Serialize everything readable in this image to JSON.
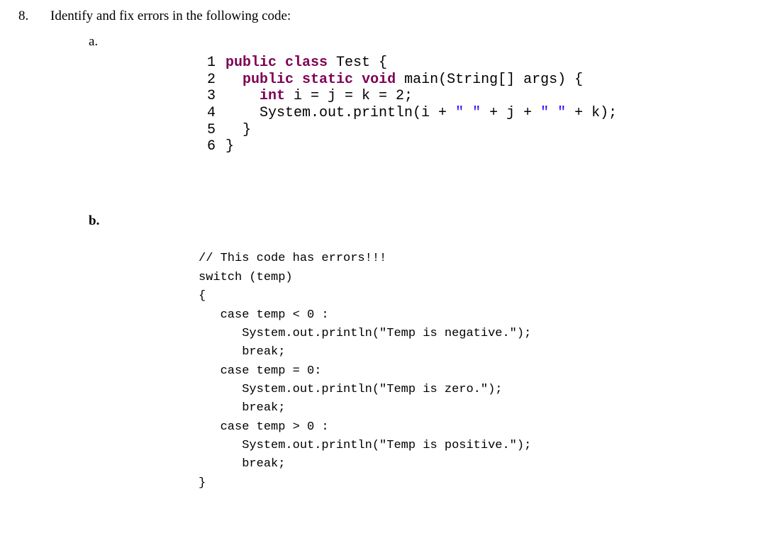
{
  "question": {
    "number": "8.",
    "prompt": "Identify and fix errors in the following code:"
  },
  "a": {
    "label": "a.",
    "lines": {
      "n1": "1",
      "n2": "2",
      "n3": "3",
      "n4": "4",
      "n5": "5",
      "n6": "6",
      "l1_kw1": "public",
      "l1_kw2": "class",
      "l1_cls": " Test {",
      "l2_kw1": "public",
      "l2_kw2": "static",
      "l2_kw3": "void",
      "l2_m": " main(String[] args) {",
      "l3_kw": "int",
      "l3_rest": " i = j = k = 2;",
      "l4_pre": "    System.out.println(i + ",
      "l4_s1": "\" \"",
      "l4_mid": " + j + ",
      "l4_s2": "\" \"",
      "l4_post": " + k);",
      "l5": "  }",
      "l6": "}"
    }
  },
  "b": {
    "label": "b.",
    "lines": {
      "c1": "// This code has errors!!!",
      "c2": "switch (temp)",
      "c3": "{",
      "c4": "   case temp < 0 :",
      "c5_pre": "      System.out.println(",
      "c5_str": "\"Temp is negative.\"",
      "c5_post": ");",
      "c6": "      break;",
      "c7": "   case temp = 0:",
      "c8_pre": "      System.out.println(",
      "c8_str": "\"Temp is zero.\"",
      "c8_post": ");",
      "c9": "      break;",
      "c10": "   case temp > 0 :",
      "c11_pre": "      System.out.println(",
      "c11_str": "\"Temp is positive.\"",
      "c11_post": ");",
      "c12": "      break;",
      "c13": "}"
    }
  }
}
